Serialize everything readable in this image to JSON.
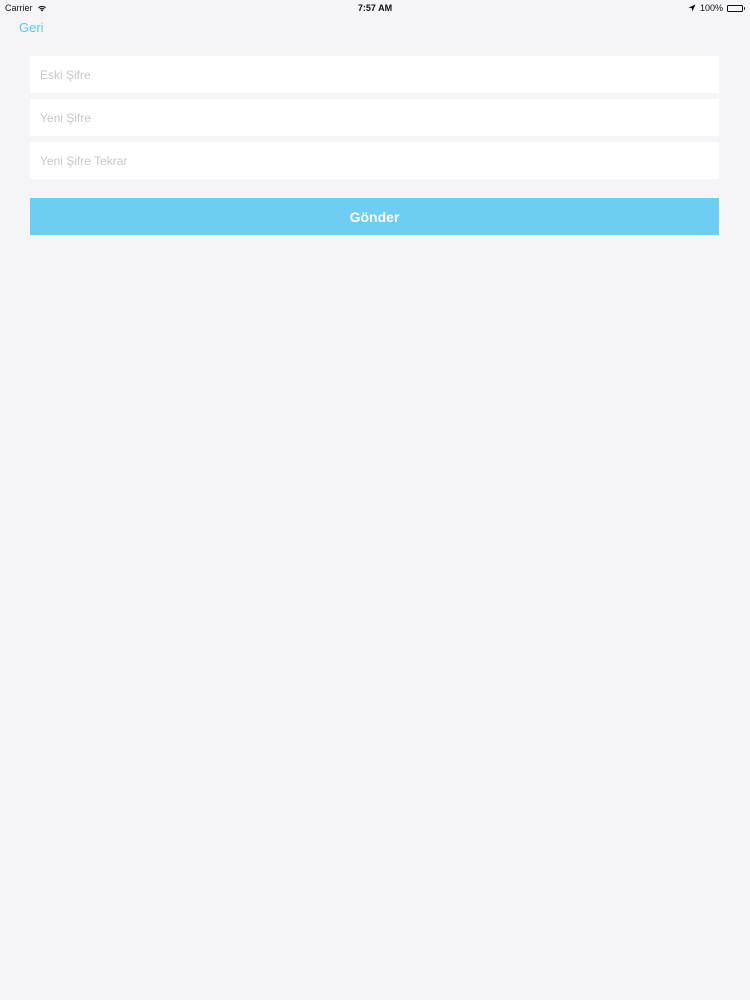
{
  "status_bar": {
    "carrier": "Carrier",
    "time": "7:57 AM",
    "battery": "100%",
    "icons": [
      "wifi-icon",
      "location-arrow-icon",
      "battery-icon"
    ]
  },
  "nav": {
    "back_label": "Geri"
  },
  "form": {
    "old_password_placeholder": "Eski Şifre",
    "new_password_placeholder": "Yeni Şifre",
    "new_password_repeat_placeholder": "Yeni Şifre Tekrar",
    "submit_label": "Gönder"
  },
  "colors": {
    "background": "#f5f4f7",
    "accent": "#5ac8f0",
    "button": "#6dcdf2",
    "field": "#ffffff",
    "placeholder": "#c7c7cc"
  }
}
